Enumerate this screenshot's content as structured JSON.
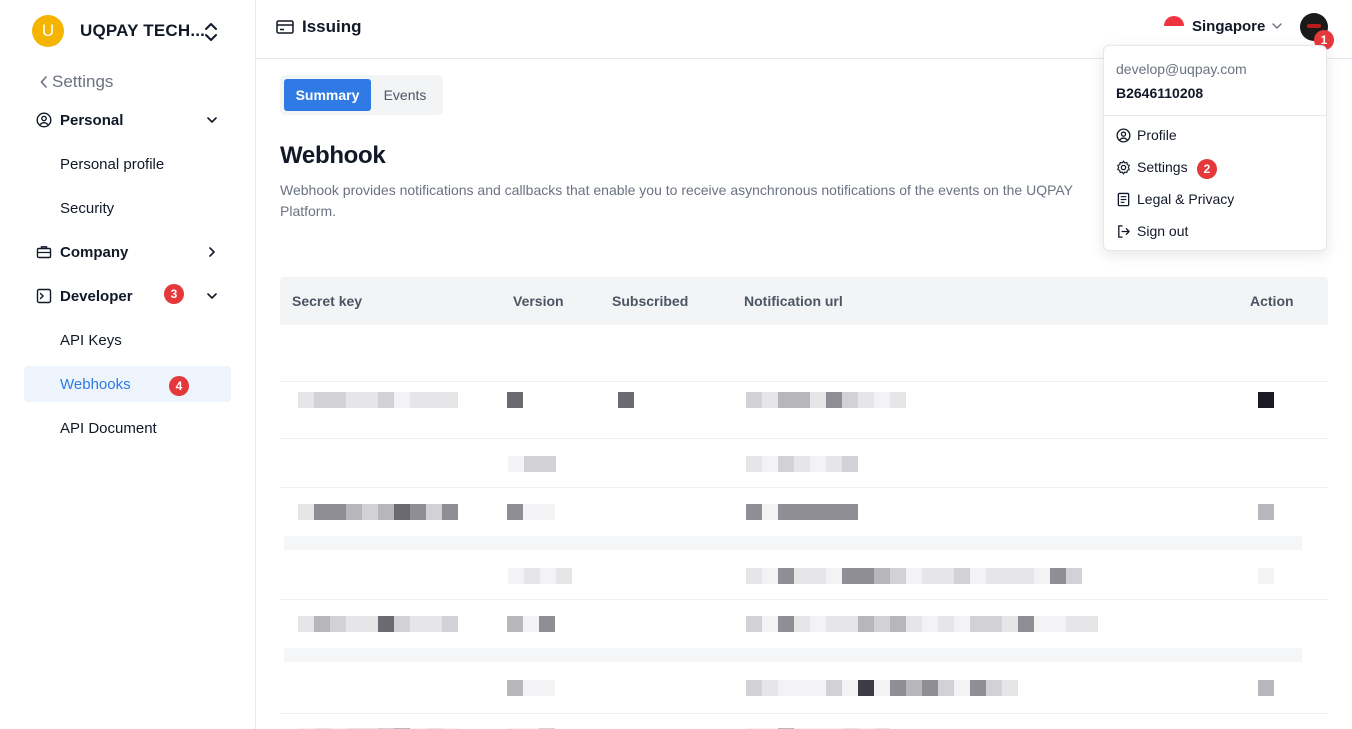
{
  "sidebar": {
    "org_initial": "U",
    "org_name": "UQPAY TECH...",
    "back_label": "Settings",
    "groups": {
      "personal": "Personal",
      "company": "Company",
      "developer": "Developer"
    },
    "items": {
      "personal_profile": "Personal profile",
      "security": "Security",
      "api_keys": "API Keys",
      "webhooks": "Webhooks",
      "api_document": "API Document"
    }
  },
  "header": {
    "title": "Issuing",
    "region": "Singapore"
  },
  "badges": {
    "one": "1",
    "two": "2",
    "three": "3",
    "four": "4"
  },
  "tabs": {
    "summary": "Summary",
    "events": "Events"
  },
  "main": {
    "title": "Webhook",
    "description": "Webhook provides notifications and callbacks that enable you to receive asynchronous notifications of the events on the UQPAY Platform."
  },
  "table": {
    "columns": {
      "secret_key": "Secret key",
      "version": "Version",
      "subscribed": "Subscribed",
      "notification_url": "Notification url",
      "action": "Action"
    }
  },
  "user_menu": {
    "email": "develop@uqpay.com",
    "account_id": "B2646110208",
    "profile": "Profile",
    "settings": "Settings",
    "legal": "Legal & Privacy",
    "sign_out": "Sign out"
  },
  "colors": {
    "accent": "#2f7ae5",
    "badge": "#e5383b",
    "org_avatar": "#f5b400"
  }
}
